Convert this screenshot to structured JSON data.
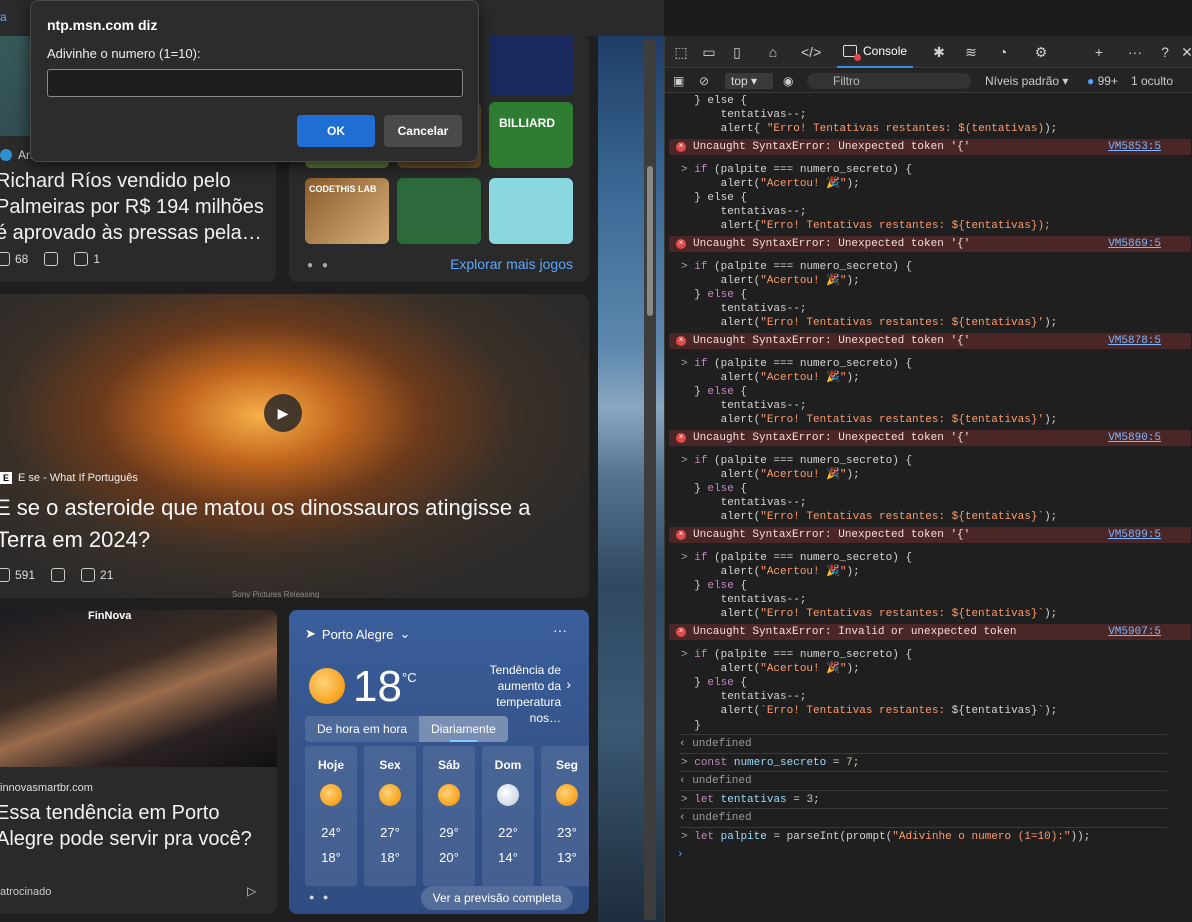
{
  "top_link": "a",
  "dialog": {
    "title": "ntp.msn.com diz",
    "message": "Adivinhe o numero (1=10):",
    "input_value": "",
    "ok_label": "OK",
    "cancel_label": "Cancelar"
  },
  "news1": {
    "source": "An",
    "title": "Richard Ríos vendido pelo Palmeiras por R$ 194 milhões é aprovado às pressas pela…",
    "likes": "68",
    "comments": "1"
  },
  "games": {
    "tile_labels": [
      "CODETHIS LAB",
      "BILLIARD"
    ],
    "explore_label": "Explorar mais jogos"
  },
  "video": {
    "source": "E se - What If Português",
    "title": "E se o asteroide que matou os dinossauros atingisse a Terra em 2024?",
    "likes": "591",
    "comments": "21",
    "credit": "Sony Pictures Releasing"
  },
  "ad": {
    "brand": "FinNova",
    "source": "innovasmartbr.com",
    "title": "Essa tendência em Porto Alegre pode servir pra você?",
    "sponsored": "atrocinado"
  },
  "weather": {
    "location": "Porto Alegre",
    "temp": "18",
    "unit": "°C",
    "trend": "Tendência de aumento da temperatura nos…",
    "tab_hourly": "De hora em hora",
    "tab_daily": "Diariamente",
    "days": [
      {
        "name": "Hoje",
        "hi": "24°",
        "lo": "18°"
      },
      {
        "name": "Sex",
        "hi": "27°",
        "lo": "18°"
      },
      {
        "name": "Sáb",
        "hi": "29°",
        "lo": "20°"
      },
      {
        "name": "Dom",
        "hi": "22°",
        "lo": "14°"
      },
      {
        "name": "Seg",
        "hi": "23°",
        "lo": "13°"
      }
    ],
    "forecast_label": "Ver a previsão completa"
  },
  "devtools": {
    "console_tab": "Console",
    "context": "top",
    "filter_placeholder": "Filtro",
    "levels": "Níveis padrão",
    "issues_count": "99+",
    "hidden": "1 oculto"
  },
  "console": {
    "lines": [
      {
        "kind": "code",
        "text": "  } else {"
      },
      {
        "kind": "code",
        "text": "      tentativas--;"
      },
      {
        "kind": "code",
        "html": "      alert{ <span class='str'>\"Erro! Tentativas restantes: $(tentativas)</span>);"
      },
      {
        "kind": "error",
        "text": "Uncaught SyntaxError: Unexpected token '{'",
        "vm": "VM5853:5"
      },
      {
        "kind": "code",
        "html": "<span class='arrow'>&gt;</span> <span class='kw'>if</span> (palpite === numero_secreto) {"
      },
      {
        "kind": "code",
        "html": "      alert(<span class='str'>\"Acertou! 🎉\"</span>);"
      },
      {
        "kind": "code",
        "text": "  } else {"
      },
      {
        "kind": "code",
        "text": "      tentativas--;"
      },
      {
        "kind": "code",
        "html": "      alert{<span class='str'>\"Erro! Tentativas restantes: ${tentativas});</span>"
      },
      {
        "kind": "error",
        "text": "Uncaught SyntaxError: Unexpected token '{'",
        "vm": "VM5869:5"
      },
      {
        "kind": "code",
        "html": "<span class='arrow'>&gt;</span> <span class='kw'>if</span> (palpite === numero_secreto) {"
      },
      {
        "kind": "code",
        "html": "      alert(<span class='str'>\"Acertou! 🎉\"</span>);"
      },
      {
        "kind": "code",
        "html": "  } <span class='kw'>else</span> {"
      },
      {
        "kind": "code",
        "text": "      tentativas--;"
      },
      {
        "kind": "code",
        "html": "      alert(<span class='str'>\"Erro! Tentativas restantes: ${tentativas}'</span>);"
      },
      {
        "kind": "error",
        "text": "Uncaught SyntaxError: Unexpected token '{'",
        "vm": "VM5878:5"
      },
      {
        "kind": "code",
        "html": "<span class='arrow'>&gt;</span> <span class='kw'>if</span> (palpite === numero_secreto) {"
      },
      {
        "kind": "code",
        "html": "      alert(<span class='str'>\"Acertou! 🎉\"</span>);"
      },
      {
        "kind": "code",
        "html": "  } <span class='kw'>else</span> {"
      },
      {
        "kind": "code",
        "text": "      tentativas--;"
      },
      {
        "kind": "code",
        "html": "      alert(<span class='str'>\"Erro! Tentativas restantes: ${tentativas}'</span>);"
      },
      {
        "kind": "error",
        "text": "Uncaught SyntaxError: Unexpected token '{'",
        "vm": "VM5890:5"
      },
      {
        "kind": "code",
        "html": "<span class='arrow'>&gt;</span> <span class='kw'>if</span> (palpite === numero_secreto) {"
      },
      {
        "kind": "code",
        "html": "      alert(<span class='str'>\"Acertou! 🎉\"</span>);"
      },
      {
        "kind": "code",
        "html": "  } <span class='kw'>else</span> {"
      },
      {
        "kind": "code",
        "text": "      tentativas--;"
      },
      {
        "kind": "code",
        "html": "      alert(<span class='str'>\"Erro! Tentativas restantes: ${tentativas}`</span>);"
      },
      {
        "kind": "error",
        "text": "Uncaught SyntaxError: Unexpected token '{'",
        "vm": "VM5899:5"
      },
      {
        "kind": "code",
        "html": "<span class='arrow'>&gt;</span> <span class='kw'>if</span> (palpite === numero_secreto) {"
      },
      {
        "kind": "code",
        "html": "      alert(<span class='str'>\"Acertou! 🎉\"</span>);"
      },
      {
        "kind": "code",
        "html": "  } <span class='kw'>else</span> {"
      },
      {
        "kind": "code",
        "text": "      tentativas--;"
      },
      {
        "kind": "code",
        "html": "      alert(<span class='str'>\"Erro! Tentativas restantes: ${tentativas}`</span>);"
      },
      {
        "kind": "error",
        "text": "Uncaught SyntaxError: Invalid or unexpected token",
        "vm": "VM5907:5"
      },
      {
        "kind": "code",
        "html": "<span class='arrow'>&gt;</span> <span class='kw'>if</span> (palpite === numero_secreto) {"
      },
      {
        "kind": "code",
        "html": "      alert(<span class='str'>\"Acertou! 🎉\"</span>);"
      },
      {
        "kind": "code",
        "html": "  } <span class='kw'>else</span> {"
      },
      {
        "kind": "code",
        "text": "      tentativas--;"
      },
      {
        "kind": "code",
        "html": "      alert(<span class='str'>`Erro! Tentativas restantes: </span>${tentativas}<span class='str'>`</span>);"
      },
      {
        "kind": "code",
        "text": "  }"
      },
      {
        "kind": "result",
        "text": "undefined"
      },
      {
        "kind": "code",
        "html": "<span class='arrow'>&gt;</span> <span class='kw'>const</span> <span class='var'>numero_secreto</span> = <span class='num'>7</span>;"
      },
      {
        "kind": "result",
        "text": "undefined"
      },
      {
        "kind": "code",
        "html": "<span class='arrow'>&gt;</span> <span class='kw'>let</span> <span class='var'>tentativas</span> = <span class='num'>3</span>;"
      },
      {
        "kind": "result",
        "text": "undefined"
      },
      {
        "kind": "code",
        "html": "<span class='arrow'>&gt;</span> <span class='kw'>let</span> <span class='var'>palpite</span> = parseInt(prompt(<span class='str'>\"Adivinhe o numero (1=10):\"</span>));"
      }
    ]
  }
}
